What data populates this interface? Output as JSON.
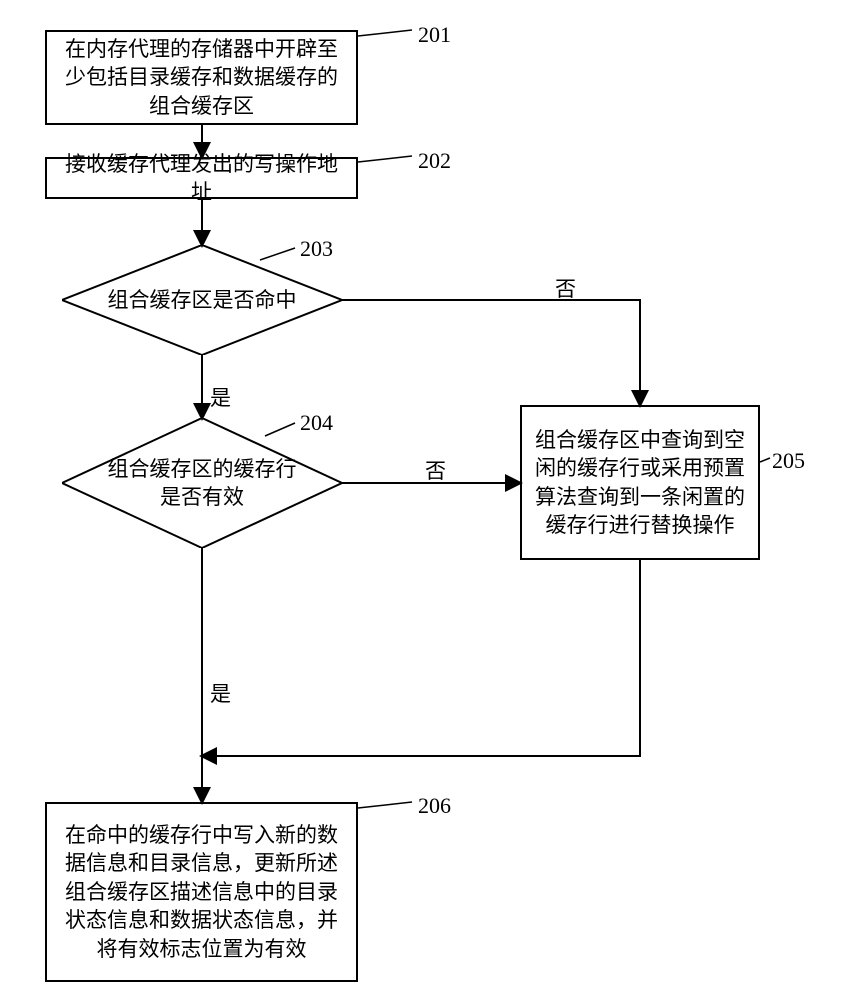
{
  "nodes": {
    "n201": {
      "ref": "201",
      "text": "在内存代理的存储器中开辟至少包括目录缓存和数据缓存的组合缓存区"
    },
    "n202": {
      "ref": "202",
      "text": "接收缓存代理发出的写操作地址"
    },
    "n203": {
      "ref": "203",
      "text": "组合缓存区是否命中"
    },
    "n204": {
      "ref": "204",
      "text": "组合缓存区的缓存行是否有效"
    },
    "n205": {
      "ref": "205",
      "text": "组合缓存区中查询到空闲的缓存行或采用预置算法查询到一条闲置的缓存行进行替换操作"
    },
    "n206": {
      "ref": "206",
      "text": "在命中的缓存行中写入新的数据信息和目录信息，更新所述组合缓存区描述信息中的目录状态信息和数据状态信息，并将有效标志位置为有效"
    }
  },
  "labels": {
    "yes": "是",
    "no": "否"
  }
}
